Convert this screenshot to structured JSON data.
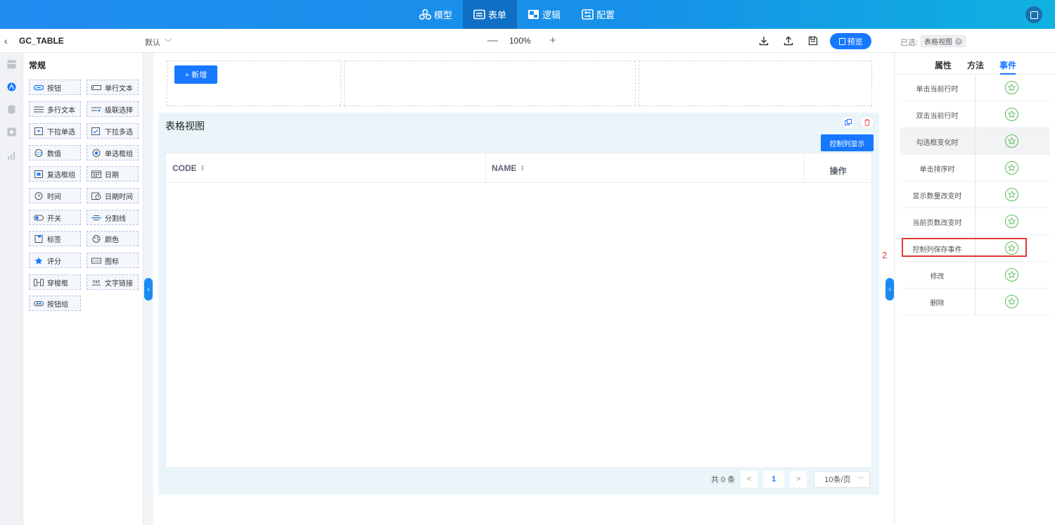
{
  "topnav": {
    "tabs": [
      {
        "label": "模型",
        "icon": "model-icon"
      },
      {
        "label": "表单",
        "icon": "form-icon",
        "active": true
      },
      {
        "label": "逻辑",
        "icon": "logic-icon"
      },
      {
        "label": "配置",
        "icon": "config-icon"
      }
    ]
  },
  "toolbar": {
    "title": "GC_TABLE",
    "default_label": "默认",
    "zoom": "100%",
    "zoom_minus": "—",
    "zoom_plus": "+",
    "preview": "预览",
    "selected_label": "已选:",
    "selected_tag": "表格视图"
  },
  "palette": {
    "heading": "常规",
    "items": [
      {
        "label": "按钮",
        "icon": "button-icon"
      },
      {
        "label": "单行文本",
        "icon": "single-line-icon"
      },
      {
        "label": "多行文本",
        "icon": "multi-line-icon"
      },
      {
        "label": "级联选择",
        "icon": "cascader-icon"
      },
      {
        "label": "下拉单选",
        "icon": "select-icon"
      },
      {
        "label": "下拉多选",
        "icon": "multi-select-icon"
      },
      {
        "label": "数值",
        "icon": "number-icon"
      },
      {
        "label": "单选框组",
        "icon": "radio-icon"
      },
      {
        "label": "复选框组",
        "icon": "checkbox-icon"
      },
      {
        "label": "日期",
        "icon": "date-icon"
      },
      {
        "label": "时间",
        "icon": "time-icon"
      },
      {
        "label": "日期时间",
        "icon": "datetime-icon"
      },
      {
        "label": "开关",
        "icon": "switch-icon"
      },
      {
        "label": "分割线",
        "icon": "divider-icon"
      },
      {
        "label": "标签",
        "icon": "tag-icon"
      },
      {
        "label": "颜色",
        "icon": "color-icon"
      },
      {
        "label": "评分",
        "icon": "rate-icon"
      },
      {
        "label": "图标",
        "icon": "icon-icon"
      },
      {
        "label": "穿梭框",
        "icon": "transfer-icon"
      },
      {
        "label": "文字链接",
        "icon": "text-link-icon"
      },
      {
        "label": "按钮组",
        "icon": "button-group-icon"
      }
    ],
    "icon_texts": {
      "number": "123",
      "icon": "ICON",
      "txt": "TXT"
    }
  },
  "canvas": {
    "add_button": "+ 新增",
    "table_title": "表格视图",
    "control_button": "控制列显示",
    "columns": [
      "CODE",
      "NAME",
      "操作"
    ],
    "pager": {
      "total": "共 0 条",
      "prev": "<",
      "page": "1",
      "next": ">",
      "size": "10条/页"
    }
  },
  "rightpanel": {
    "tabs": [
      "属性",
      "方法",
      "事件"
    ],
    "active_tab": "事件",
    "events": [
      "单击当前行时",
      "双击当前行时",
      "勾选框变化时",
      "单击排序时",
      "显示数量改变时",
      "当前页数改变时",
      "控制列保存事件",
      "修改",
      "删除"
    ],
    "annotation": "2"
  },
  "colors": {
    "accent": "#1677ff",
    "event_icon": "#5cb85c",
    "highlight": "#e53935"
  }
}
